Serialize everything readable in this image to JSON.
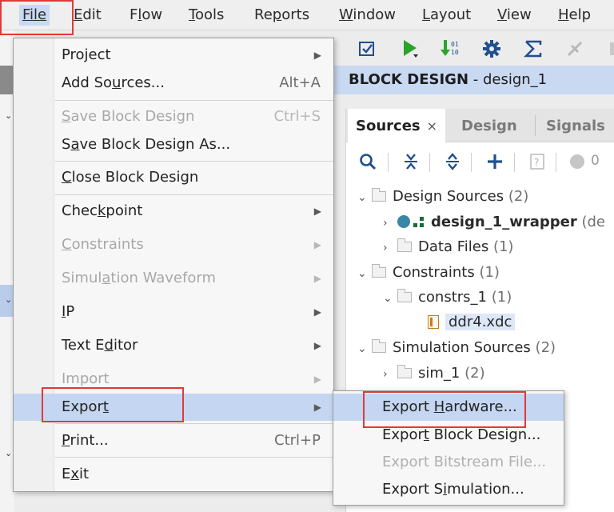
{
  "menubar": {
    "items": [
      {
        "label": "File",
        "mnemonic_index": 0
      },
      {
        "label": "Edit",
        "mnemonic_index": 0
      },
      {
        "label": "Flow",
        "mnemonic_index": 1
      },
      {
        "label": "Tools",
        "mnemonic_index": 0
      },
      {
        "label": "Reports",
        "mnemonic_index": 2
      },
      {
        "label": "Window",
        "mnemonic_index": 0
      },
      {
        "label": "Layout",
        "mnemonic_index": 0
      },
      {
        "label": "View",
        "mnemonic_index": 0
      },
      {
        "label": "Help",
        "mnemonic_index": 0
      }
    ]
  },
  "header": {
    "title_bold": "BLOCK DESIGN",
    "title_rest": " - design_1"
  },
  "sources": {
    "tabs": [
      {
        "label": "Sources",
        "active": true
      },
      {
        "label": "Design",
        "active": false
      },
      {
        "label": "Signals",
        "active": false
      }
    ],
    "tab_close_glyph": "×",
    "toolbar": {
      "badge_count": "0"
    },
    "tree": [
      {
        "label": "Design Sources",
        "count": "(2)"
      },
      {
        "label": "design_1_wrapper",
        "suffix": "(de"
      },
      {
        "label": "Data Files",
        "count": "(1)"
      },
      {
        "label": "Constraints",
        "count": "(1)"
      },
      {
        "label": "constrs_1",
        "count": "(1)"
      },
      {
        "label": "ddr4.xdc",
        "count": ""
      },
      {
        "label": "Simulation Sources",
        "count": "(2)"
      },
      {
        "label": "sim_1",
        "count": "(2)"
      }
    ]
  },
  "file_menu": {
    "items": [
      {
        "label": "Project",
        "mnemonic": "",
        "shortcut": "",
        "submenu": true,
        "disabled": false
      },
      {
        "label": "Add Sources...",
        "mnemonic": "u",
        "shortcut": "Alt+A",
        "submenu": false,
        "disabled": false
      },
      {
        "label": "Save Block Design",
        "mnemonic": "S",
        "shortcut": "Ctrl+S",
        "submenu": false,
        "disabled": true
      },
      {
        "label": "Save Block Design As...",
        "mnemonic": "a",
        "shortcut": "",
        "submenu": false,
        "disabled": false
      },
      {
        "label": "Close Block Design",
        "mnemonic": "C",
        "shortcut": "",
        "submenu": false,
        "disabled": false
      },
      {
        "label": "Checkpoint",
        "mnemonic": "k",
        "shortcut": "",
        "submenu": true,
        "disabled": false
      },
      {
        "label": "Constraints",
        "mnemonic": "C",
        "shortcut": "",
        "submenu": true,
        "disabled": true
      },
      {
        "label": "Simulation Waveform",
        "mnemonic": "a",
        "shortcut": "",
        "submenu": true,
        "disabled": true
      },
      {
        "label": "IP",
        "mnemonic": "I",
        "shortcut": "",
        "submenu": true,
        "disabled": false
      },
      {
        "label": "Text Editor",
        "mnemonic": "d",
        "shortcut": "",
        "submenu": true,
        "disabled": false
      },
      {
        "label": "Import",
        "mnemonic": "",
        "shortcut": "",
        "submenu": true,
        "disabled": true
      },
      {
        "label": "Export",
        "mnemonic": "t",
        "shortcut": "",
        "submenu": true,
        "disabled": false,
        "highlighted": true
      },
      {
        "label": "Print...",
        "mnemonic": "P",
        "shortcut": "Ctrl+P",
        "submenu": false,
        "disabled": false
      },
      {
        "label": "Exit",
        "mnemonic": "x",
        "shortcut": "",
        "submenu": false,
        "disabled": false
      }
    ]
  },
  "export_submenu": {
    "items": [
      {
        "label": "Export Hardware...",
        "mnemonic": "H",
        "disabled": false,
        "highlighted": true
      },
      {
        "label": "Export Block Design...",
        "mnemonic": "t",
        "disabled": false
      },
      {
        "label": "Export Bitstream File...",
        "mnemonic": "",
        "disabled": true
      },
      {
        "label": "Export Simulation...",
        "mnemonic": "i",
        "disabled": false
      }
    ]
  },
  "colors": {
    "highlight": "#c4d6f1",
    "header_bg": "#c9d9f2",
    "annotation_red": "#e03a3a",
    "run_green": "#2aa52a",
    "toolbar_blue": "#1f4f8f"
  },
  "icons": [
    "checkbox-validate-icon",
    "run-icon",
    "download-bits-icon",
    "gear-icon",
    "sigma-icon",
    "search-icon",
    "collapse-all-icon",
    "expand-all-icon",
    "add-icon",
    "help-icon",
    "status-dot-icon",
    "folder-icon",
    "block-design-icon",
    "constraint-file-icon"
  ]
}
